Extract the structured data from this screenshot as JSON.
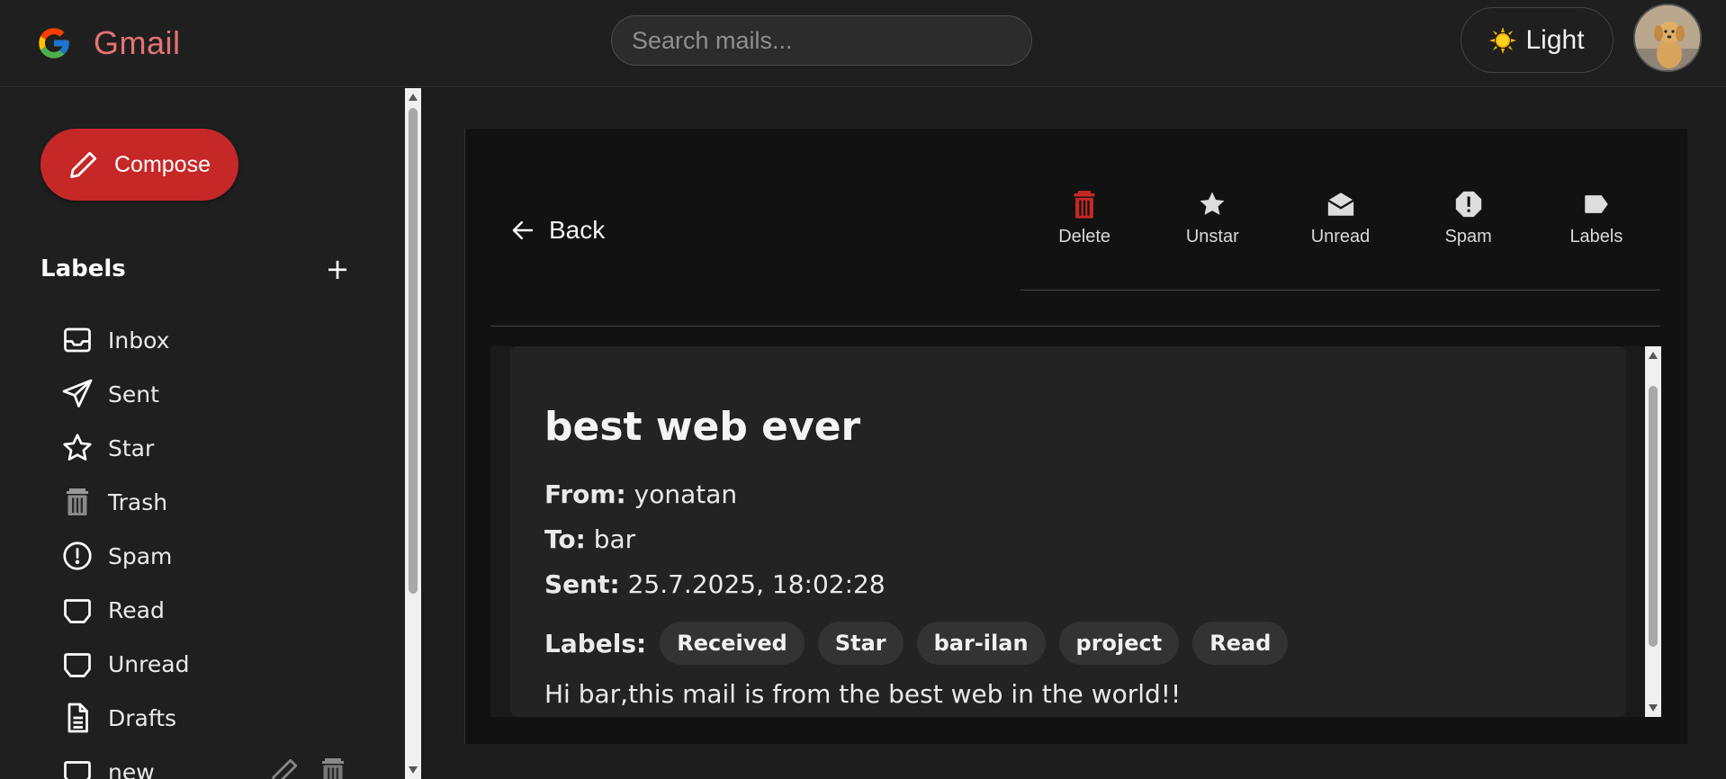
{
  "header": {
    "brand": "Gmail",
    "search_placeholder": "Search mails...",
    "theme_label": "Light",
    "theme_icon": "sun-icon"
  },
  "sidebar": {
    "compose_label": "Compose",
    "labels_title": "Labels",
    "add_label_symbol": "+",
    "items": [
      {
        "label": "Inbox",
        "icon": "inbox-icon"
      },
      {
        "label": "Sent",
        "icon": "send-icon"
      },
      {
        "label": "Star",
        "icon": "star-icon"
      },
      {
        "label": "Trash",
        "icon": "trash-icon"
      },
      {
        "label": "Spam",
        "icon": "spam-icon"
      },
      {
        "label": "Read",
        "icon": "tag-icon"
      },
      {
        "label": "Unread",
        "icon": "tag-icon"
      },
      {
        "label": "Drafts",
        "icon": "document-icon"
      },
      {
        "label": "new",
        "icon": "tag-icon"
      }
    ]
  },
  "toolbar": {
    "back_label": "Back",
    "actions": [
      {
        "label": "Delete",
        "icon": "trash-icon",
        "color": "#c62828"
      },
      {
        "label": "Unstar",
        "icon": "star-icon"
      },
      {
        "label": "Unread",
        "icon": "mail-icon"
      },
      {
        "label": "Spam",
        "icon": "spam-icon"
      },
      {
        "label": "Labels",
        "icon": "label-icon"
      }
    ]
  },
  "email": {
    "subject": "best web ever",
    "from_label": "From:",
    "from": "yonatan",
    "to_label": "To:",
    "to": "bar",
    "sent_label": "Sent:",
    "sent": "25.7.2025, 18:02:28",
    "labels_label": "Labels:",
    "labels": [
      "Received",
      "Star",
      "bar-ilan",
      "project",
      "Read"
    ],
    "body": "Hi bar,this mail is from the best web in the world!!"
  },
  "colors": {
    "accent": "#c62828",
    "brand": "#e57373",
    "background": "#1c1c1c"
  }
}
